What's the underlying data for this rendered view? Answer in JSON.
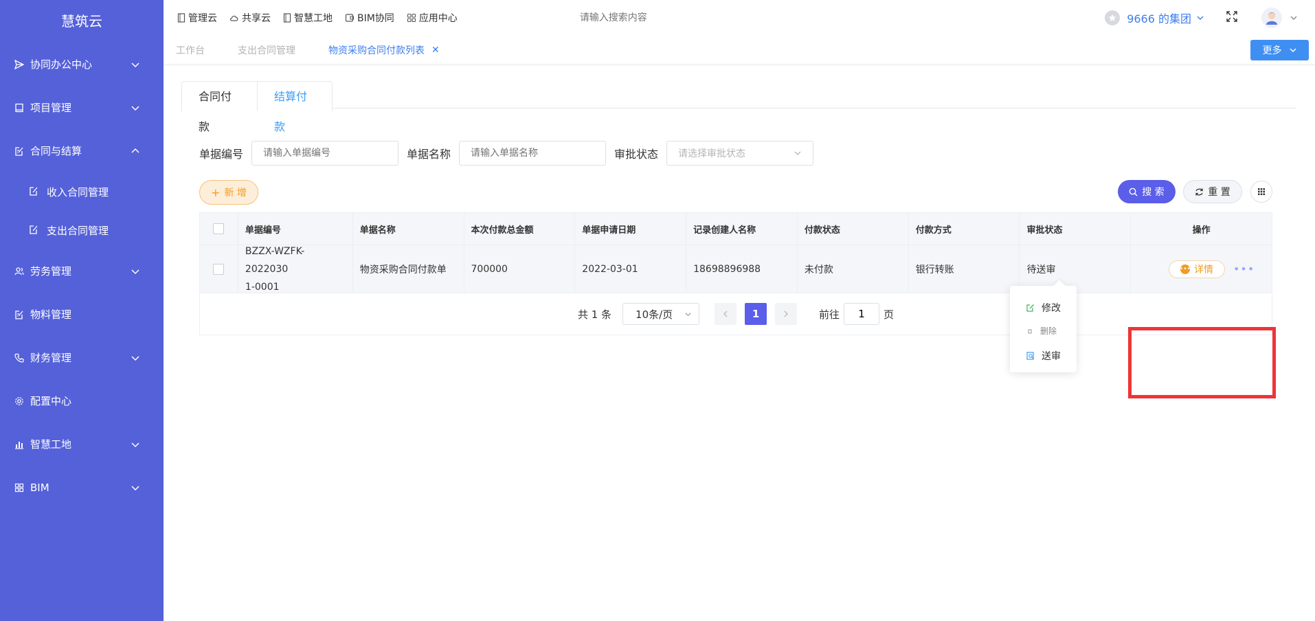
{
  "brand": "慧筑云",
  "sidebar": {
    "items": [
      {
        "label": "协同办公中心",
        "icon": "send-icon",
        "expandable": true,
        "expanded": false
      },
      {
        "label": "项目管理",
        "icon": "book-icon",
        "expandable": true,
        "expanded": false
      },
      {
        "label": "合同与结算",
        "icon": "edit-doc-icon",
        "expandable": true,
        "expanded": true
      },
      {
        "label": "劳务管理",
        "icon": "users-icon",
        "expandable": true,
        "expanded": false
      },
      {
        "label": "物料管理",
        "icon": "edit-doc-icon",
        "expandable": false
      },
      {
        "label": "财务管理",
        "icon": "phone-icon",
        "expandable": true,
        "expanded": false
      },
      {
        "label": "配置中心",
        "icon": "gear-icon",
        "expandable": false
      },
      {
        "label": "智慧工地",
        "icon": "bar-chart-icon",
        "expandable": true,
        "expanded": false
      },
      {
        "label": "BIM",
        "icon": "grid-icon",
        "expandable": true,
        "expanded": false
      }
    ],
    "subitems": [
      {
        "label": "收入合同管理"
      },
      {
        "label": "支出合同管理"
      }
    ]
  },
  "topnav": {
    "items": [
      {
        "label": "管理云",
        "icon": "doc-icon"
      },
      {
        "label": "共享云",
        "icon": "cloud-icon"
      },
      {
        "label": "智慧工地",
        "icon": "doc-icon"
      },
      {
        "label": "BIM协同",
        "icon": "box-icon"
      },
      {
        "label": "应用中心",
        "icon": "apps-icon"
      }
    ],
    "search_placeholder": "请输入搜索内容",
    "org_name": "9666 的集团"
  },
  "page_tabs": {
    "items": [
      "工作台",
      "支出合同管理",
      "物资采购合同付款列表"
    ],
    "active": "物资采购合同付款列表",
    "more_label": "更多"
  },
  "card_tabs": {
    "tab1": "合同付款",
    "tab2": "结算付款",
    "active": "结算付款"
  },
  "filters": {
    "doc_no_label": "单据编号",
    "doc_no_placeholder": "请输入单据编号",
    "doc_name_label": "单据名称",
    "doc_name_placeholder": "请输入单据名称",
    "status_label": "审批状态",
    "status_placeholder": "请选择审批状态"
  },
  "actions": {
    "add_label": "新 增",
    "search_label": "搜 索",
    "reset_label": "重 置"
  },
  "table": {
    "headers": [
      "单据编号",
      "单据名称",
      "本次付款总金额",
      "单据申请日期",
      "记录创建人名称",
      "付款状态",
      "付款方式",
      "审批状态",
      "操作"
    ],
    "rows": [
      {
        "doc_no": "BZZX-WZFK-20220301-0001",
        "doc_no_line1": "BZZX-WZFK-2022030",
        "doc_no_line2": "1-0001",
        "doc_name": "物资采购合同付款单",
        "amount": "700000",
        "date": "2022-03-01",
        "creator": "18698896988",
        "pay_status": "未付款",
        "pay_method": "银行转账",
        "approval_status": "待送审",
        "detail_label": "详情"
      }
    ]
  },
  "pagination": {
    "total": "共 1 条",
    "page_size": "10条/页",
    "current_page": "1",
    "goto_prefix": "前往",
    "goto_value": "1",
    "goto_suffix": "页"
  },
  "dropdown": {
    "items": [
      {
        "label": "修改",
        "icon": "edit-icon",
        "color": "#3fb35f"
      },
      {
        "label": "删除",
        "icon": "delete-icon",
        "color": "#999999"
      },
      {
        "label": "送审",
        "icon": "submit-review-icon",
        "color": "#3d9cf5"
      }
    ]
  },
  "colors": {
    "sidebar_bg": "#5561d9",
    "primary": "#5a5ee9",
    "link_blue": "#3d7ef0",
    "orange": "#f29b22",
    "highlight_red": "#ee3438"
  }
}
